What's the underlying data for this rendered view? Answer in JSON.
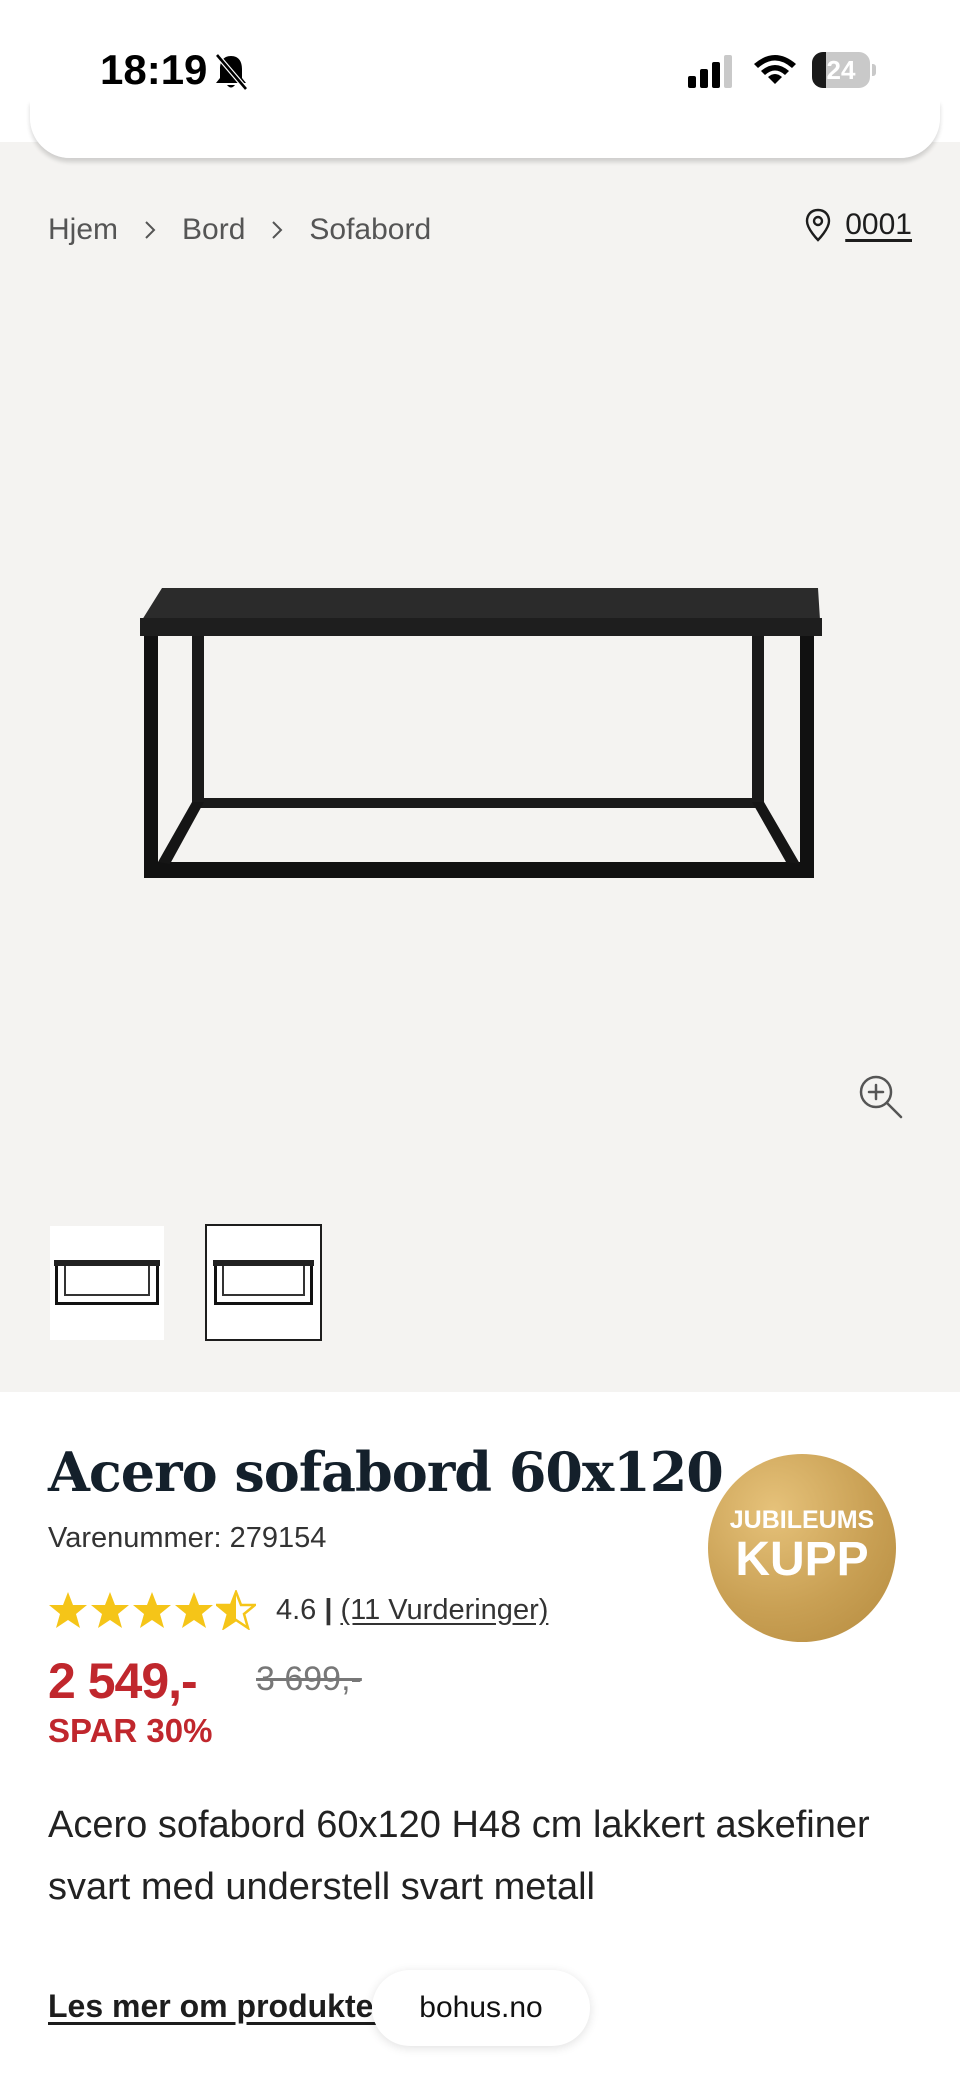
{
  "status_bar": {
    "time": "18:19",
    "battery": "24",
    "battery_level": 0.24,
    "icons": [
      "bell-muted-icon",
      "cellular-signal-icon",
      "wifi-icon",
      "battery-icon"
    ]
  },
  "breadcrumb": {
    "items": [
      "Hjem",
      "Bord",
      "Sofabord"
    ]
  },
  "store": {
    "code": "0001",
    "icon": "location-pin-icon"
  },
  "gallery": {
    "thumbnail_count": 2,
    "selected_thumbnail": 2
  },
  "product": {
    "title": "Acero sofabord 60x120",
    "sku_label": "Varenummer: 279154",
    "rating_value": "4.6",
    "rating_separator": "|",
    "reviews_link": "(11 Vurderinger)",
    "rating_stars": 4.6,
    "price": "2 549,-",
    "old_price": "3 699,-",
    "saving": "SPAR 30%",
    "badge_line1": "JUBILEUMS",
    "badge_line2": "KUPP",
    "description": "Acero sofabord 60x120 H48 cm lakkert askefiner svart med understell svart metall",
    "read_more": "Les mer om produktet"
  },
  "browser": {
    "url": "bohus.no"
  },
  "colors": {
    "accent_red": "#c0272d",
    "star_yellow": "#f5c518",
    "gallery_bg": "#f4f3f1",
    "badge_gold": "#c9a054"
  }
}
